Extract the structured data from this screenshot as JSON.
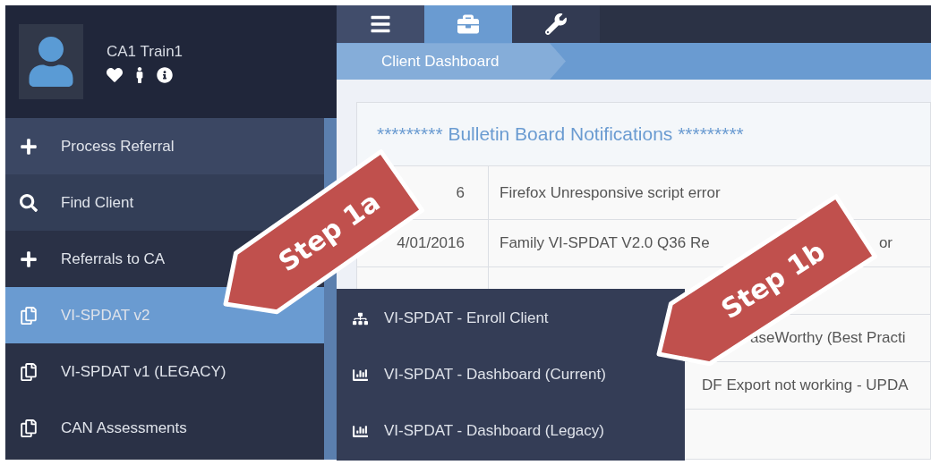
{
  "user": {
    "name": "CA1 Train1"
  },
  "toolbar": {
    "tabs": [
      {
        "kind": "menu",
        "selected": false
      },
      {
        "kind": "briefcase",
        "selected": true
      },
      {
        "kind": "wrench",
        "selected": false
      }
    ]
  },
  "breadcrumb": {
    "label": "Client Dashboard"
  },
  "sidebar": {
    "items": [
      {
        "kind": "plus",
        "label": "Process Referral",
        "selected": false
      },
      {
        "kind": "search",
        "label": "Find Client",
        "selected": false
      },
      {
        "kind": "plus",
        "label": "Referrals to CA",
        "selected": false
      },
      {
        "kind": "files",
        "label": "VI-SPDAT v2",
        "selected": true
      },
      {
        "kind": "files",
        "label": "VI-SPDAT v1 (LEGACY)",
        "selected": false
      },
      {
        "kind": "files",
        "label": "CAN Assessments",
        "selected": false
      }
    ]
  },
  "submenu": {
    "items": [
      {
        "kind": "sitemap",
        "label": "VI-SPDAT - Enroll Client"
      },
      {
        "kind": "chart",
        "label": "VI-SPDAT - Dashboard (Current)"
      },
      {
        "kind": "chart",
        "label": "VI-SPDAT - Dashboard (Legacy)"
      }
    ]
  },
  "bulletin": {
    "title": "********* Bulletin Board Notifications *********",
    "rows": [
      {
        "kind": "full",
        "date": "6",
        "description": "Firefox Unresponsive script error"
      },
      {
        "kind": "full",
        "date": "4/01/2016",
        "description": "Family VI-SPDAT V2.0 Q36 Re",
        "description_end": "or"
      },
      {
        "kind": "hidden"
      },
      {
        "kind": "clipped_far",
        "description": "aseWorthy (Best Practi"
      },
      {
        "kind": "clipped",
        "description": "DF Export not working - UPDA"
      }
    ]
  },
  "callouts": [
    {
      "label": "Step 1a"
    },
    {
      "label": "Step 1b"
    }
  ]
}
